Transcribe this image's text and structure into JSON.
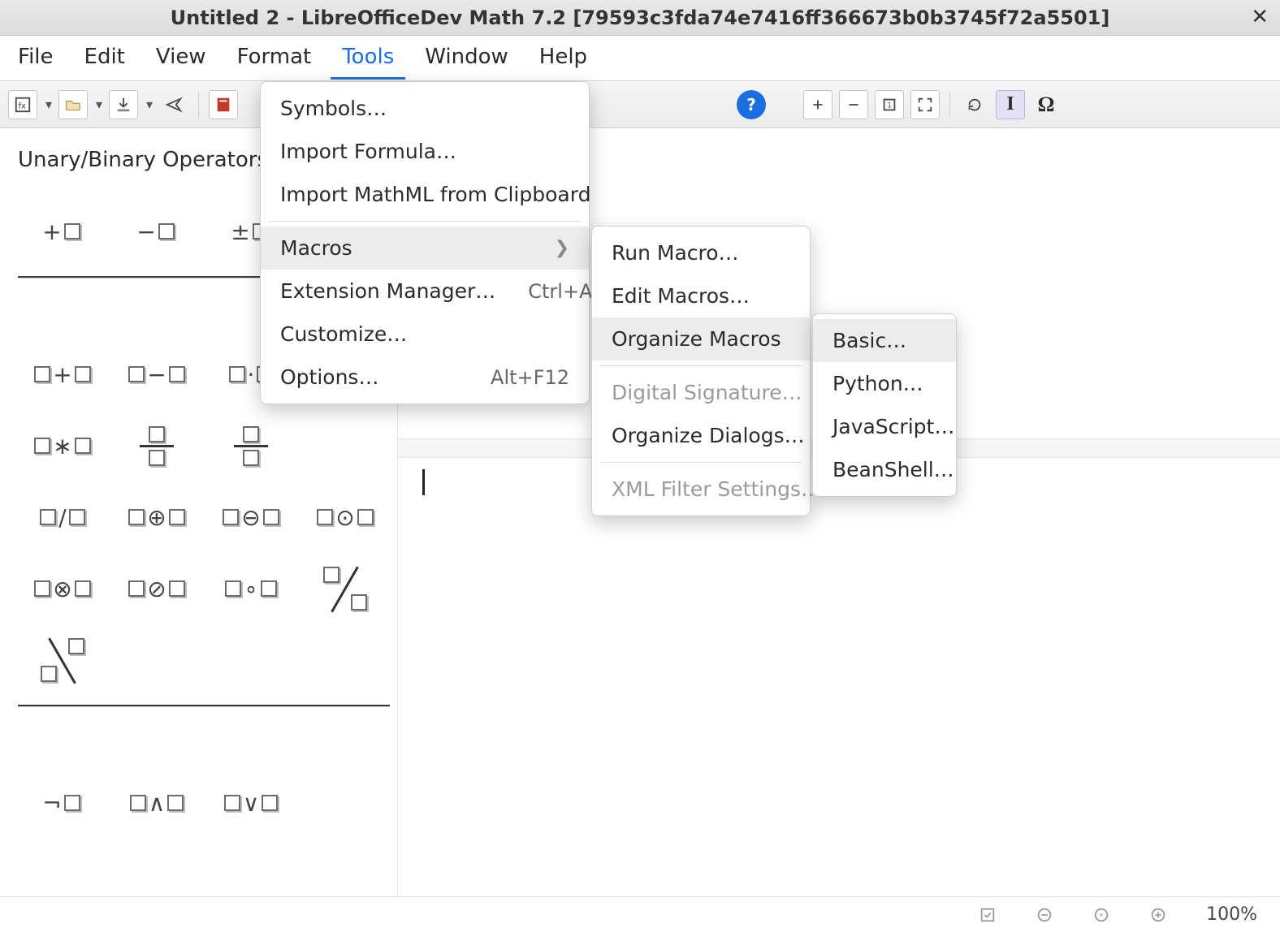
{
  "window": {
    "title": "Untitled 2 - LibreOfficeDev Math 7.2 [79593c3fda74e7416ff366673b0b3745f72a5501]"
  },
  "menubar": {
    "items": [
      "File",
      "Edit",
      "View",
      "Format",
      "Tools",
      "Window",
      "Help"
    ],
    "active_index": 4
  },
  "tools_menu": {
    "symbols": "Symbols…",
    "import_formula": "Import Formula…",
    "import_mathml": "Import MathML from Clipboard",
    "macros": "Macros",
    "ext_mgr": "Extension Manager…",
    "ext_mgr_shortcut": "Ctrl+Alt+E",
    "customize": "Customize…",
    "options": "Options…",
    "options_shortcut": "Alt+F12"
  },
  "macros_menu": {
    "run": "Run Macro…",
    "edit": "Edit Macros…",
    "organize": "Organize Macros",
    "digital_sig": "Digital Signature…",
    "dialogs": "Organize Dialogs…",
    "xml_filter": "XML Filter Settings…"
  },
  "organize_menu": {
    "basic": "Basic…",
    "python": "Python…",
    "javascript": "JavaScript…",
    "beanshell": "BeanShell…"
  },
  "sidepanel": {
    "title": "Unary/Binary Operators"
  },
  "status": {
    "zoom": "100%"
  }
}
